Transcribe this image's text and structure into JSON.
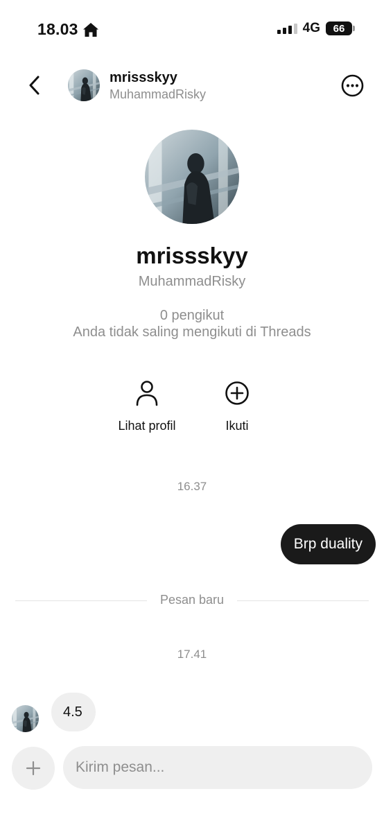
{
  "status_bar": {
    "time": "18.03",
    "network": "4G",
    "battery": "66"
  },
  "header": {
    "username": "mrissskyy",
    "display_name": "MuhammadRisky"
  },
  "profile": {
    "username": "mrissskyy",
    "display_name": "MuhammadRisky",
    "followers": "0 pengikut",
    "mutual_note": "Anda tidak saling mengikuti di Threads",
    "actions": {
      "view_profile": "Lihat profil",
      "follow": "Ikuti"
    }
  },
  "conversation": {
    "timestamp_1": "16.37",
    "outgoing_message": "Brp duality",
    "divider_label": "Pesan baru",
    "timestamp_2": "17.41",
    "incoming_message": "4.5"
  },
  "composer": {
    "placeholder": "Kirim pesan..."
  },
  "icons": {
    "home": "home-icon",
    "back": "chevron-left-icon",
    "more": "more-options-icon",
    "person": "person-icon",
    "plus_circle": "plus-circle-icon",
    "plus": "plus-icon"
  },
  "colors": {
    "outgoing_bubble": "#1a1a1a",
    "incoming_bubble": "#efefef",
    "muted_text": "#8e8e8e"
  }
}
